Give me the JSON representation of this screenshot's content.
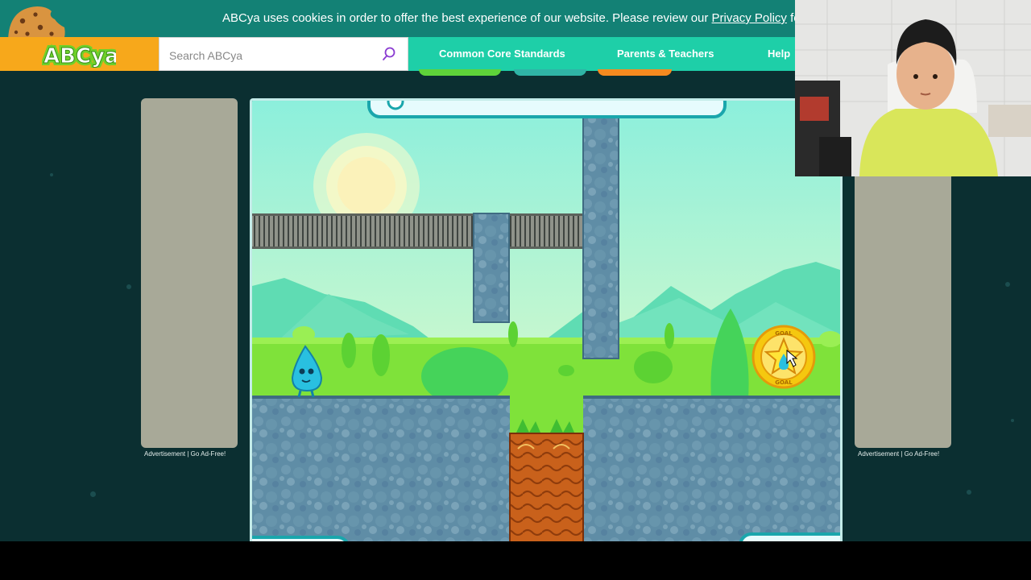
{
  "cookie_banner": {
    "message": "ABCya uses cookies in order to offer the best experience of our website. Please review our ",
    "link_label": "Privacy Policy",
    "suffix": " for mor"
  },
  "header": {
    "logo_text": "ABCya",
    "search": {
      "placeholder": "Search ABCya",
      "value": ""
    },
    "nav": [
      "Common Core Standards",
      "Parents & Teachers",
      "Help"
    ]
  },
  "ads": {
    "left_label": "Advertisement | Go Ad-Free!",
    "right_label": "Advertisement | Go Ad-Free!"
  },
  "game": {
    "goal_label": "GOAL",
    "character": "water-drop",
    "elements": [
      "sun",
      "mountains",
      "metal-grate-bridge",
      "stone-pillars",
      "dirt-block-with-sprouts",
      "goal-star-coin"
    ]
  },
  "colors": {
    "cookie_bar": "#138175",
    "nav_bar": "#1ecfa8",
    "logo_bg": "#f7a81b",
    "page_bg": "#0b2f31",
    "sky": "#9fefdc",
    "grass": "#7fe23a",
    "stone": "#5d8aa2",
    "dirt": "#c8621a",
    "goal": "#f5c80f"
  }
}
